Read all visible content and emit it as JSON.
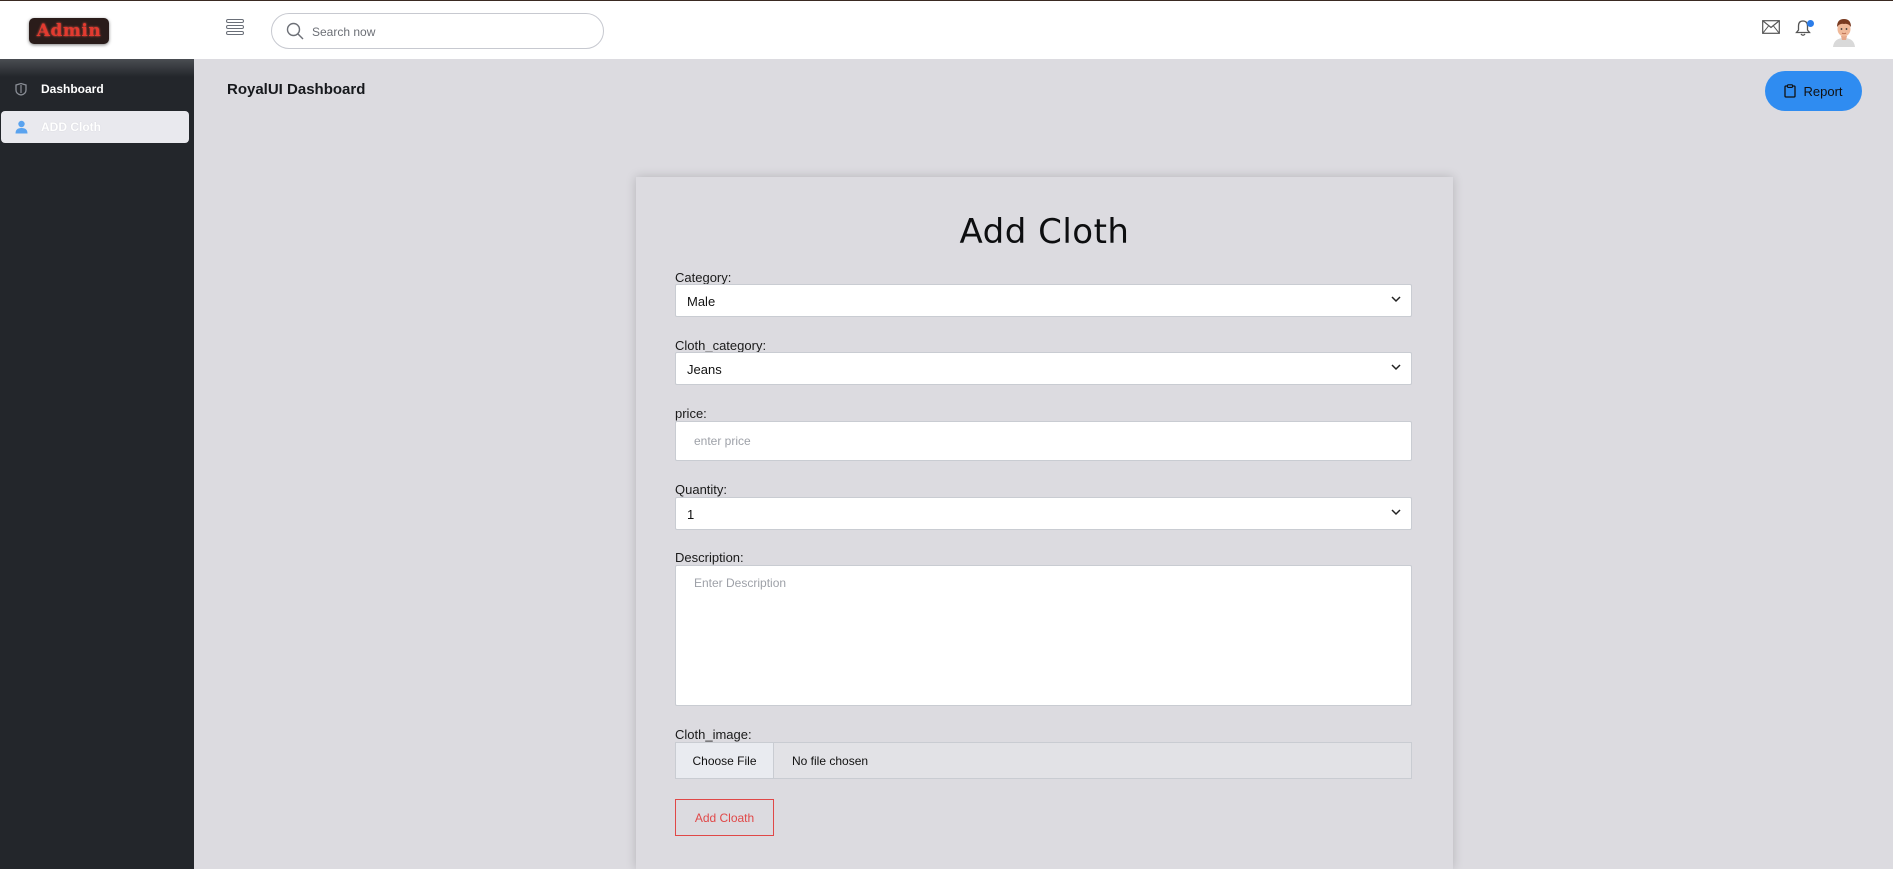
{
  "brand": {
    "logo_text": "Admin"
  },
  "search": {
    "placeholder": "Search now"
  },
  "sidebar": {
    "items": [
      {
        "label": "Dashboard",
        "icon": "dashboard-icon"
      },
      {
        "label": "ADD Cloth",
        "icon": "user-icon",
        "active": true
      }
    ]
  },
  "header": {
    "title": "RoyalUI Dashboard",
    "report_label": "Report"
  },
  "form": {
    "title": "Add Cloth",
    "category": {
      "label": "Category:",
      "value": "Male"
    },
    "cloth_category": {
      "label": "Cloth_category:",
      "value": "Jeans"
    },
    "price": {
      "label": "price:",
      "placeholder": "enter price"
    },
    "quantity": {
      "label": "Quantity:",
      "value": "1"
    },
    "description": {
      "label": "Description:",
      "placeholder": "Enter Description"
    },
    "cloth_image": {
      "label": "Cloth_image:",
      "button_label": "Choose File",
      "status": "No file chosen"
    },
    "submit_label": "Add Cloath"
  },
  "colors": {
    "accent": "#2f8cf1",
    "notification_dot": "#2b7de9",
    "submit": "#e04848",
    "sidebar_bg": "#23262b",
    "content_bg": "#dcdbe0"
  }
}
